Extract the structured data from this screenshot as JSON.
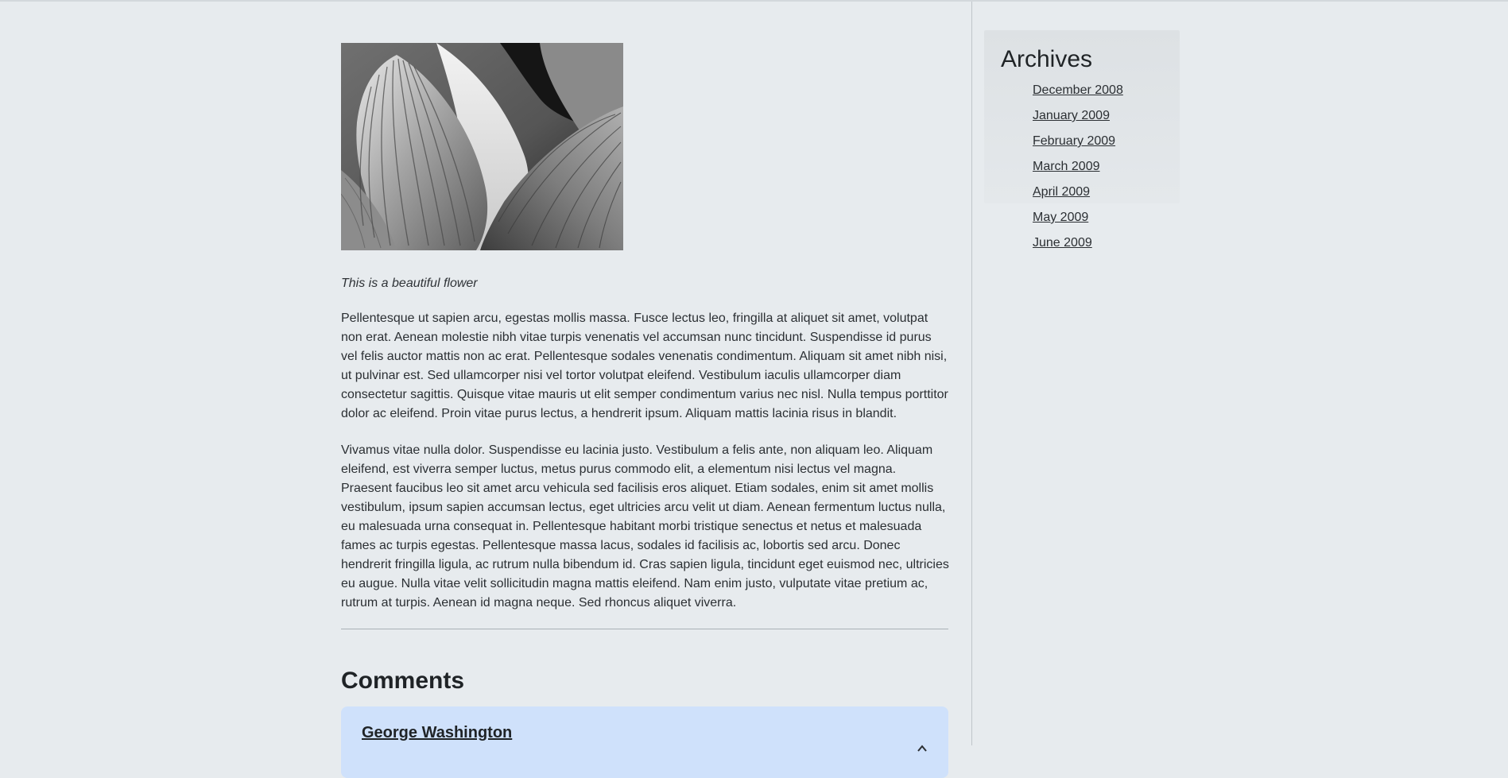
{
  "post": {
    "image_caption": "This is a beautiful flower",
    "paragraphs": [
      "Pellentesque ut sapien arcu, egestas mollis massa. Fusce lectus leo, fringilla at aliquet sit amet, volutpat non erat. Aenean molestie nibh vitae turpis venenatis vel accumsan nunc tincidunt. Suspendisse id purus vel felis auctor mattis non ac erat. Pellentesque sodales venenatis condimentum. Aliquam sit amet nibh nisi, ut pulvinar est. Sed ullamcorper nisi vel tortor volutpat eleifend. Vestibulum iaculis ullamcorper diam consectetur sagittis. Quisque vitae mauris ut elit semper condimentum varius nec nisl. Nulla tempus porttitor dolor ac eleifend. Proin vitae purus lectus, a hendrerit ipsum. Aliquam mattis lacinia risus in blandit.",
      "Vivamus vitae nulla dolor. Suspendisse eu lacinia justo. Vestibulum a felis ante, non aliquam leo. Aliquam eleifend, est viverra semper luctus, metus purus commodo elit, a elementum nisi lectus vel magna. Praesent faucibus leo sit amet arcu vehicula sed facilisis eros aliquet. Etiam sodales, enim sit amet mollis vestibulum, ipsum sapien accumsan lectus, eget ultricies arcu velit ut diam. Aenean fermentum luctus nulla, eu malesuada urna consequat in. Pellentesque habitant morbi tristique senectus et netus et malesuada fames ac turpis egestas. Pellentesque massa lacus, sodales id facilisis ac, lobortis sed arcu. Donec hendrerit fringilla ligula, ac rutrum nulla bibendum id. Cras sapien ligula, tincidunt eget euismod nec, ultricies eu augue. Nulla vitae velit sollicitudin magna mattis eleifend. Nam enim justo, vulputate vitae pretium ac, rutrum at turpis. Aenean id magna neque. Sed rhoncus aliquet viverra."
    ]
  },
  "comments": {
    "heading": "Comments",
    "items": [
      {
        "author": "George Washington"
      }
    ]
  },
  "sidebar": {
    "archives_title": "Archives",
    "links": [
      "December 2008",
      "January 2009",
      "February 2009",
      "March 2009",
      "April 2009",
      "May 2009",
      "June 2009"
    ]
  },
  "colors": {
    "page_background": "#e7ebee",
    "comment_card": "#cfe1fb",
    "text": "#2b2f33"
  },
  "icons": {
    "comment_toggle": "chevron-up-icon"
  }
}
